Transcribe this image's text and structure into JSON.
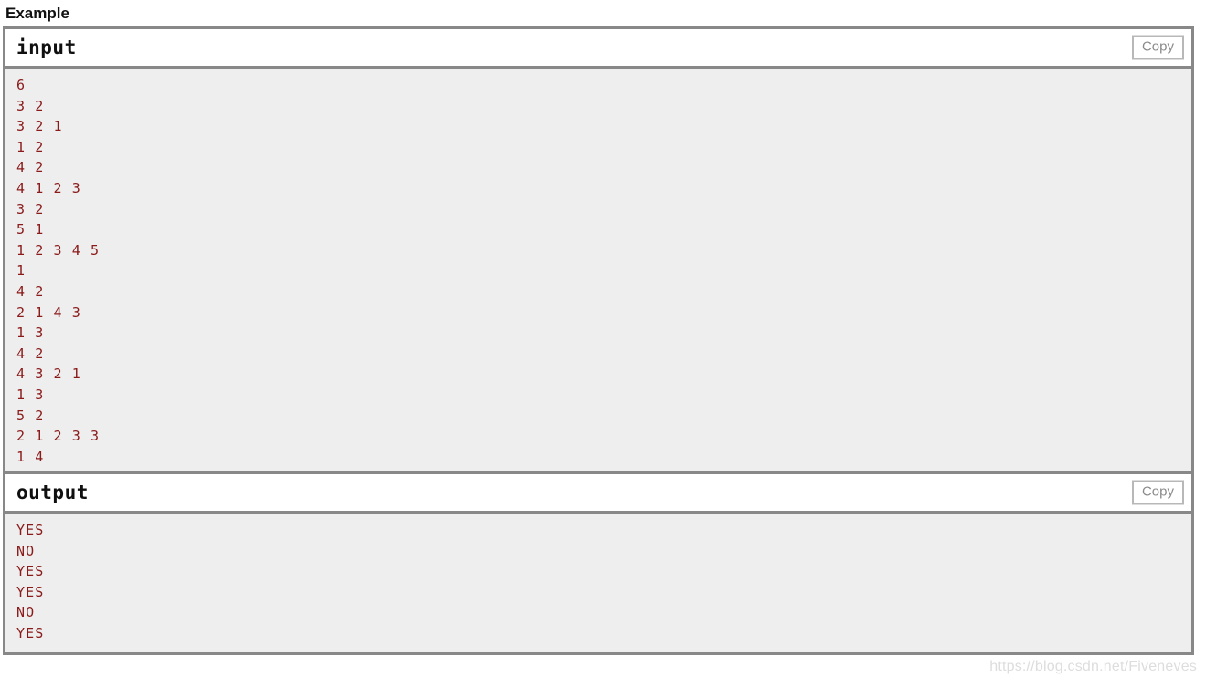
{
  "section": {
    "title": "Example"
  },
  "colors": {
    "code_text": "#8b1a1a",
    "panel_border": "#888888",
    "body_background": "#eeeeee",
    "header_background": "#ffffff",
    "copy_button_text": "#8a8a8a",
    "watermark": "#dddddd"
  },
  "blocks": [
    {
      "title": "input",
      "copy_label": "Copy",
      "lines": [
        "6",
        "3 2",
        "3 2 1",
        "1 2",
        "4 2",
        "4 1 2 3",
        "3 2",
        "5 1",
        "1 2 3 4 5",
        "1",
        "4 2",
        "2 1 4 3",
        "1 3",
        "4 2",
        "4 3 2 1",
        "1 3",
        "5 2",
        "2 1 2 3 3",
        "1 4"
      ]
    },
    {
      "title": "output",
      "copy_label": "Copy",
      "lines": [
        "YES",
        "NO",
        "YES",
        "YES",
        "NO",
        "YES"
      ]
    }
  ],
  "watermark": {
    "text": "https://blog.csdn.net/Fiveneves"
  }
}
